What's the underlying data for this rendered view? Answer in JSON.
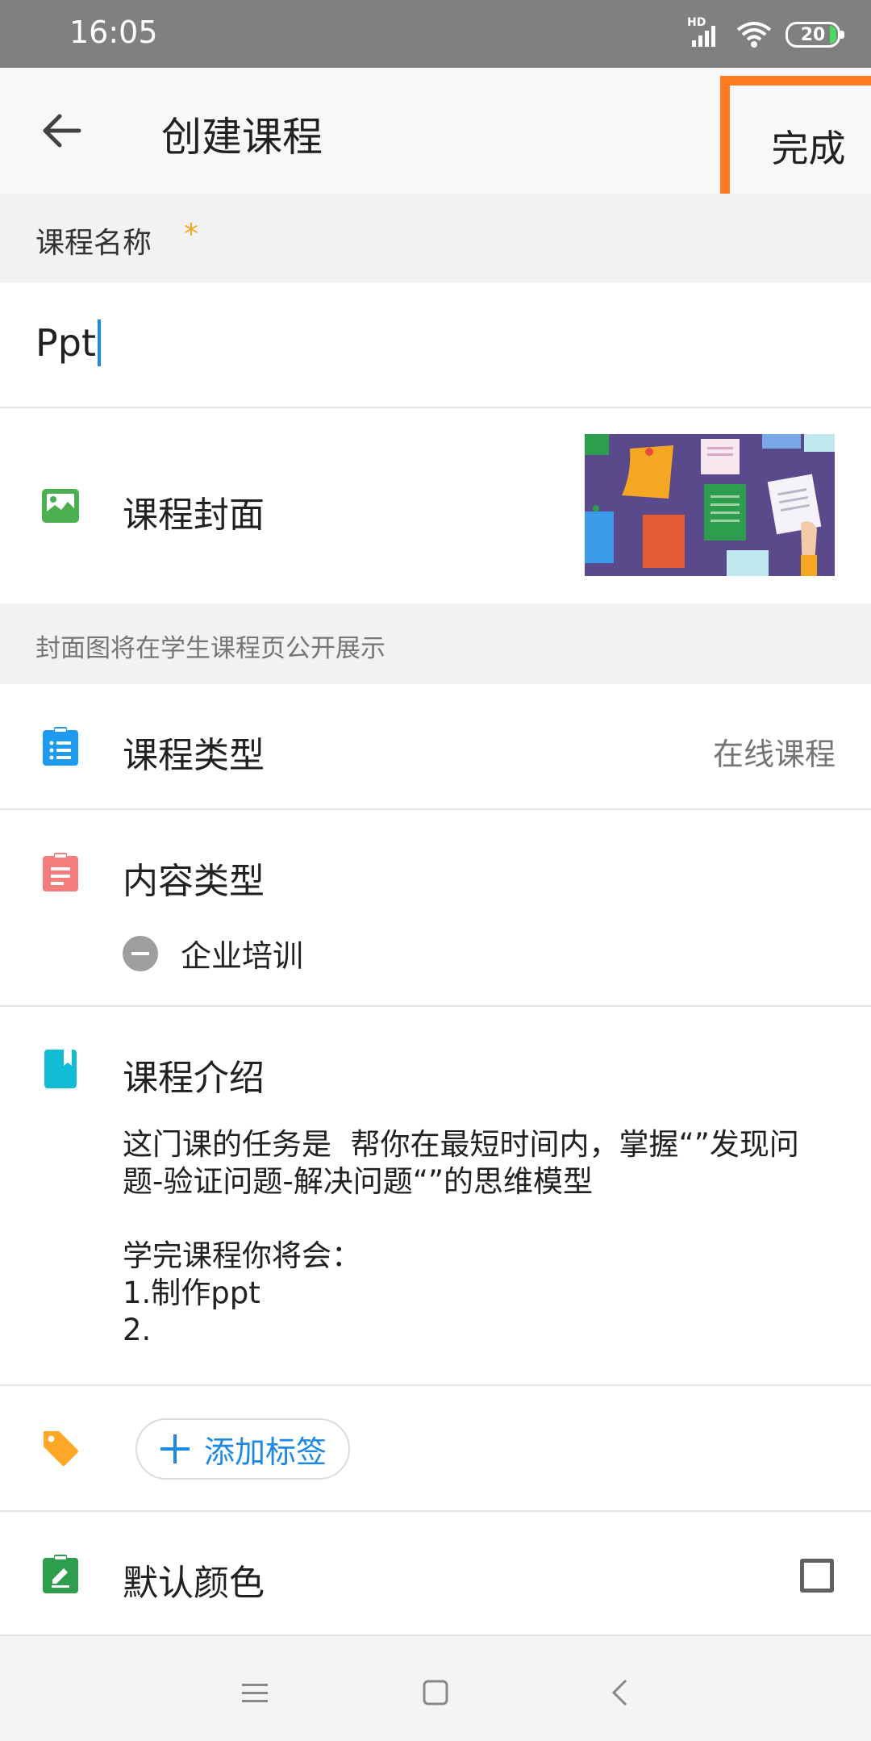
{
  "status_bar": {
    "time": "16:05",
    "network": "HD",
    "battery": "20",
    "icons": [
      "signal-icon",
      "wifi-icon",
      "battery-icon"
    ]
  },
  "app_bar": {
    "title": "创建课程",
    "done_label": "完成",
    "back_icon": "arrow-left-icon",
    "highlight_color": "#ff7a21"
  },
  "course_name": {
    "header": "课程名称",
    "required_mark": "*",
    "value": "Ppt"
  },
  "cover": {
    "label": "课程封面",
    "icon": "image-icon",
    "note": "封面图将在学生课程页公开展示"
  },
  "course_type": {
    "label": "课程类型",
    "value": "在线课程",
    "icon": "clipboard-list-icon"
  },
  "content_type": {
    "label": "内容类型",
    "icon": "clipboard-text-icon",
    "chip": "企业培训"
  },
  "intro": {
    "label": "课程介绍",
    "icon": "bookmark-book-icon",
    "text": "这门课的任务是  帮你在最短时间内，掌握“”发现问题-验证问题-解决问题“”的思维模型\n\n学完课程你将会：\n1.制作ppt\n2."
  },
  "tags": {
    "icon": "tag-icon",
    "add_label": "添加标签"
  },
  "default_color": {
    "label": "默认颜色",
    "icon": "clipboard-edit-icon",
    "checked": false
  },
  "nav_bar": {
    "icons": [
      "menu-icon",
      "home-icon",
      "back-nav-icon"
    ]
  },
  "colors": {
    "accent_blue": "#1e88e5",
    "icon_green": "#4caf50",
    "icon_blue": "#1e9bf0",
    "icon_red": "#f47c7c",
    "icon_cyan": "#13bcd4",
    "icon_orange": "#ffa726",
    "icon_dark_green": "#2e9d4e"
  }
}
